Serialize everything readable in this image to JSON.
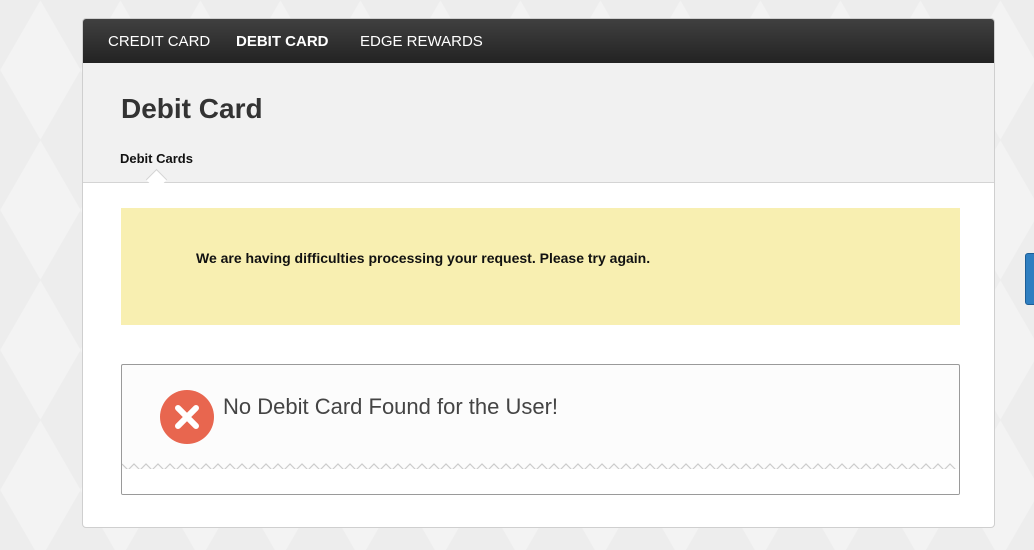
{
  "nav": {
    "items": [
      {
        "label": "CREDIT CARD"
      },
      {
        "label": "DEBIT CARD",
        "active": true
      },
      {
        "label": "EDGE REWARDS"
      }
    ]
  },
  "page": {
    "title": "Debit Card",
    "subtab": "Debit Cards"
  },
  "alert": {
    "message": "We are having difficulties processing your request. Please try again.",
    "color": "#f8efb1"
  },
  "error": {
    "icon": "close-circle-icon",
    "message": "No Debit Card Found for the User!",
    "icon_color": "#e8664f"
  }
}
